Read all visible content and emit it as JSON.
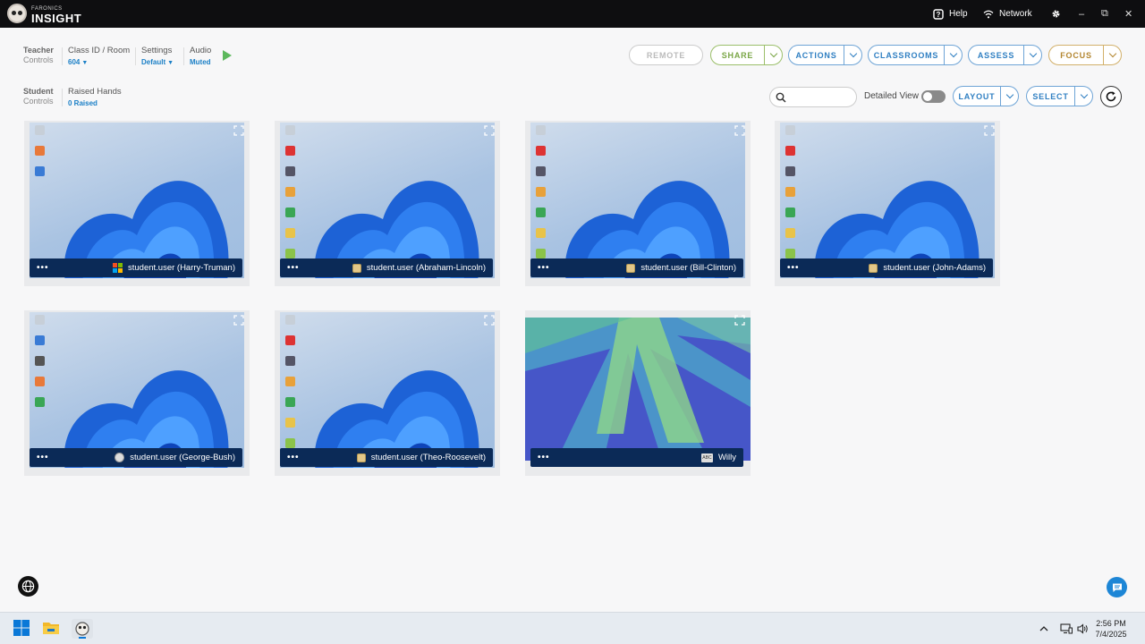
{
  "titlebar": {
    "brand_sub": "FARONICS",
    "brand_main": "INSIGHT",
    "help_label": "Help",
    "network_label": "Network"
  },
  "teacher_controls": {
    "section_bold": "Teacher",
    "section_sub": "Controls",
    "class_label": "Class ID / Room",
    "class_value": "604",
    "settings_label": "Settings",
    "settings_value": "Default",
    "audio_label": "Audio",
    "audio_value": "Muted"
  },
  "student_controls": {
    "section_bold": "Student",
    "section_sub": "Controls",
    "raised_label": "Raised Hands",
    "raised_value": "0 Raised"
  },
  "toolbar": {
    "remote": "REMOTE",
    "share": "SHARE",
    "actions": "ACTIONS",
    "classrooms": "CLASSROOMS",
    "assess": "ASSESS",
    "focus": "FOCUS"
  },
  "view_bar": {
    "search_placeholder": "",
    "detailed_view_label": "Detailed View",
    "detailed_view_on": false,
    "layout": "LAYOUT",
    "select": "SELECT"
  },
  "tiles": [
    {
      "user": "student.user (Harry-Truman)",
      "os": "windows"
    },
    {
      "user": "student.user (Abraham-Lincoln)",
      "os": "generic"
    },
    {
      "user": "student.user (Bill-Clinton)",
      "os": "generic"
    },
    {
      "user": "student.user (John-Adams)",
      "os": "generic"
    },
    {
      "user": "student.user (George-Bush)",
      "os": "mac"
    },
    {
      "user": "student.user (Theo-Roosevelt)",
      "os": "generic"
    },
    {
      "user": "Willy",
      "os": "chromeos",
      "os_text": "ABC"
    }
  ],
  "taskbar": {
    "time": "2:56 PM",
    "date": "7/4/2025"
  },
  "colors": {
    "accent_blue": "#2f7fc2",
    "share_green": "#7aa646",
    "focus_gold": "#b38630",
    "tile_bar": "#0b2a57",
    "titlebar": "#0e0e10"
  }
}
